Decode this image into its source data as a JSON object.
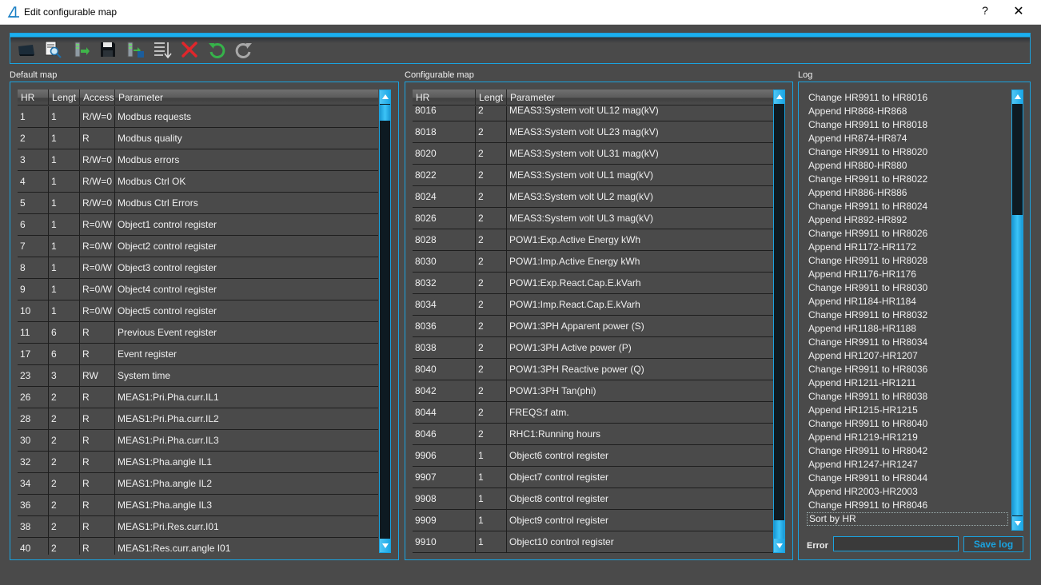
{
  "window": {
    "title": "Edit configurable map",
    "help_label": "?",
    "close_label": "✕"
  },
  "toolbar": {
    "buttons": [
      "open-icon",
      "preview-icon",
      "import-icon",
      "save-icon",
      "export-icon",
      "sort-icon",
      "delete-icon",
      "undo-icon",
      "redo-icon"
    ]
  },
  "default_map": {
    "label": "Default map",
    "columns": [
      "HR",
      "Lengt",
      "Access",
      "Parameter"
    ],
    "rows": [
      [
        "1",
        "1",
        "R/W=0",
        "Modbus requests"
      ],
      [
        "2",
        "1",
        "R",
        "Modbus quality"
      ],
      [
        "3",
        "1",
        "R/W=0",
        "Modbus errors"
      ],
      [
        "4",
        "1",
        "R/W=0",
        "Modbus Ctrl OK"
      ],
      [
        "5",
        "1",
        "R/W=0",
        "Modbus Ctrl Errors"
      ],
      [
        "6",
        "1",
        "R=0/W",
        "Object1 control register"
      ],
      [
        "7",
        "1",
        "R=0/W",
        "Object2 control register"
      ],
      [
        "8",
        "1",
        "R=0/W",
        "Object3 control register"
      ],
      [
        "9",
        "1",
        "R=0/W",
        "Object4 control register"
      ],
      [
        "10",
        "1",
        "R=0/W",
        "Object5 control register"
      ],
      [
        "11",
        "6",
        "R",
        "Previous Event register"
      ],
      [
        "17",
        "6",
        "R",
        "Event register"
      ],
      [
        "23",
        "3",
        "RW",
        "System time"
      ],
      [
        "26",
        "2",
        "R",
        "MEAS1:Pri.Pha.curr.IL1"
      ],
      [
        "28",
        "2",
        "R",
        "MEAS1:Pri.Pha.curr.IL2"
      ],
      [
        "30",
        "2",
        "R",
        "MEAS1:Pri.Pha.curr.IL3"
      ],
      [
        "32",
        "2",
        "R",
        "MEAS1:Pha.angle IL1"
      ],
      [
        "34",
        "2",
        "R",
        "MEAS1:Pha.angle IL2"
      ],
      [
        "36",
        "2",
        "R",
        "MEAS1:Pha.angle IL3"
      ],
      [
        "38",
        "2",
        "R",
        "MEAS1:Pri.Res.curr.I01"
      ],
      [
        "40",
        "2",
        "R",
        "MEAS1:Res.curr.angle I01"
      ]
    ]
  },
  "configurable_map": {
    "label": "Configurable map",
    "columns": [
      "HR",
      "Lengt",
      "Parameter"
    ],
    "rows": [
      [
        "8016",
        "2",
        "MEAS3:System volt UL12 mag(kV)"
      ],
      [
        "8018",
        "2",
        "MEAS3:System volt UL23 mag(kV)"
      ],
      [
        "8020",
        "2",
        "MEAS3:System volt UL31 mag(kV)"
      ],
      [
        "8022",
        "2",
        "MEAS3:System volt UL1 mag(kV)"
      ],
      [
        "8024",
        "2",
        "MEAS3:System volt UL2 mag(kV)"
      ],
      [
        "8026",
        "2",
        "MEAS3:System volt UL3 mag(kV)"
      ],
      [
        "8028",
        "2",
        "POW1:Exp.Active Energy kWh"
      ],
      [
        "8030",
        "2",
        "POW1:Imp.Active Energy kWh"
      ],
      [
        "8032",
        "2",
        "POW1:Exp.React.Cap.E.kVarh"
      ],
      [
        "8034",
        "2",
        "POW1:Imp.React.Cap.E.kVarh"
      ],
      [
        "8036",
        "2",
        "POW1:3PH Apparent power (S)"
      ],
      [
        "8038",
        "2",
        "POW1:3PH Active power (P)"
      ],
      [
        "8040",
        "2",
        "POW1:3PH Reactive power (Q)"
      ],
      [
        "8042",
        "2",
        "POW1:3PH Tan(phi)"
      ],
      [
        "8044",
        "2",
        "FREQS:f atm."
      ],
      [
        "8046",
        "2",
        "RHC1:Running hours"
      ],
      [
        "9906",
        "1",
        "Object6 control register"
      ],
      [
        "9907",
        "1",
        "Object7 control register"
      ],
      [
        "9908",
        "1",
        "Object8 control register"
      ],
      [
        "9909",
        "1",
        "Object9 control register"
      ],
      [
        "9910",
        "1",
        "Object10 control register"
      ]
    ]
  },
  "log": {
    "label": "Log",
    "entries": [
      "Change HR9911 to HR8016",
      "Append HR868-HR868",
      "Change HR9911 to HR8018",
      "Append HR874-HR874",
      "Change HR9911 to HR8020",
      "Append HR880-HR880",
      "Change HR9911 to HR8022",
      "Append HR886-HR886",
      "Change HR9911 to HR8024",
      "Append HR892-HR892",
      "Change HR9911 to HR8026",
      "Append HR1172-HR1172",
      "Change HR9911 to HR8028",
      "Append HR1176-HR1176",
      "Change HR9911 to HR8030",
      "Append HR1184-HR1184",
      "Change HR9911 to HR8032",
      "Append HR1188-HR1188",
      "Change HR9911 to HR8034",
      "Append HR1207-HR1207",
      "Change HR9911 to HR8036",
      "Append HR1211-HR1211",
      "Change HR9911 to HR8038",
      "Append HR1215-HR1215",
      "Change HR9911 to HR8040",
      "Append HR1219-HR1219",
      "Change HR9911 to HR8042",
      "Append HR1247-HR1247",
      "Change HR9911 to HR8044",
      "Append HR2003-HR2003",
      "Change HR9911 to HR8046",
      "Sort by HR"
    ],
    "selected_index": 31,
    "error_label": "Error",
    "error_value": "",
    "save_label": "Save log"
  },
  "colors": {
    "accent": "#1aa3e0",
    "background": "#4a4a4a",
    "delete": "#e0262b",
    "undo": "#36b24a"
  }
}
